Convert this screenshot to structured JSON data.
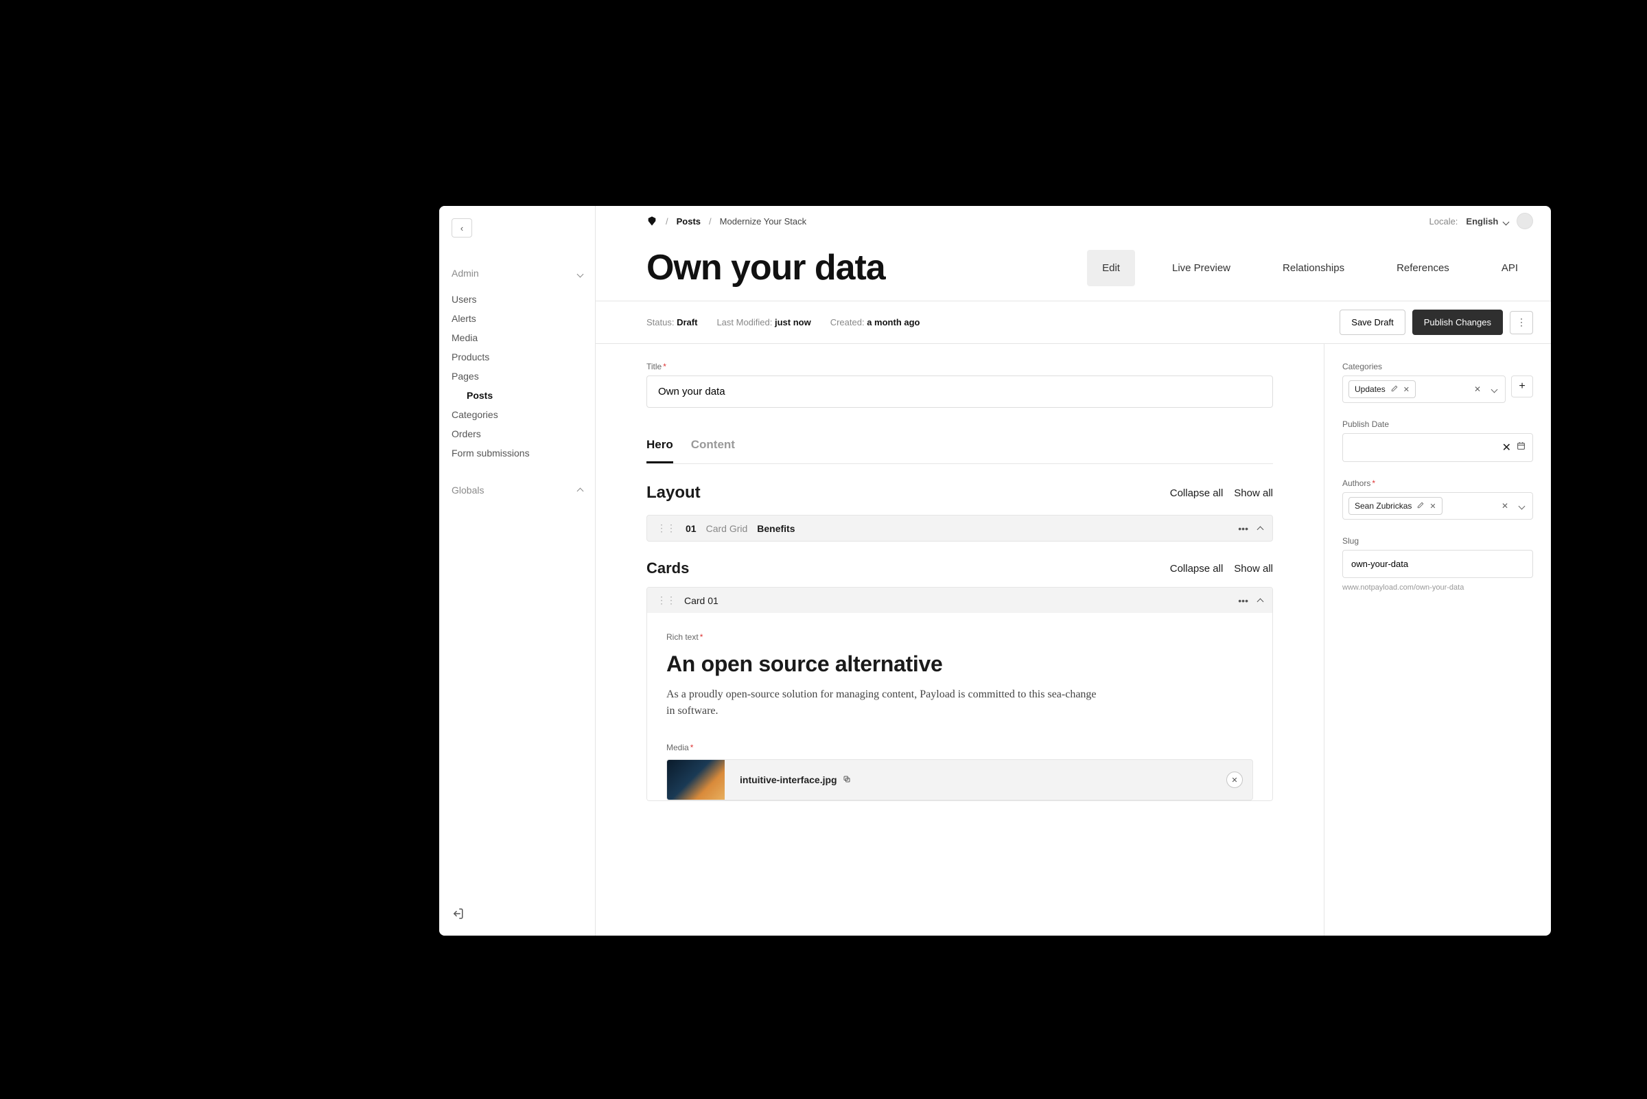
{
  "sidebar": {
    "groups": [
      {
        "label": "Admin",
        "items": [
          "Users",
          "Alerts",
          "Media",
          "Products",
          "Pages",
          "Posts",
          "Categories",
          "Orders",
          "Form submissions"
        ],
        "active": "Posts"
      },
      {
        "label": "Globals",
        "items": []
      }
    ]
  },
  "header": {
    "breadcrumb": {
      "collection": "Posts",
      "item": "Modernize Your Stack"
    },
    "locale_label": "Locale:",
    "locale_value": "English"
  },
  "page": {
    "title": "Own your data",
    "view_tabs": [
      "Edit",
      "Live Preview",
      "Relationships",
      "References",
      "API"
    ],
    "active_view": "Edit"
  },
  "status_bar": {
    "status_label": "Status:",
    "status_value": "Draft",
    "modified_label": "Last Modified:",
    "modified_value": "just now",
    "created_label": "Created:",
    "created_value": "a month ago",
    "save_draft": "Save Draft",
    "publish": "Publish Changes"
  },
  "form": {
    "title_label": "Title",
    "title_value": "Own your data",
    "tabs": [
      "Hero",
      "Content"
    ],
    "active_tab": "Hero",
    "layout": {
      "heading": "Layout",
      "collapse_all": "Collapse all",
      "show_all": "Show all",
      "block": {
        "index": "01",
        "type": "Card Grid",
        "name": "Benefits"
      }
    },
    "cards": {
      "heading": "Cards",
      "collapse_all": "Collapse all",
      "show_all": "Show all",
      "card": {
        "title": "Card 01",
        "rich_text_label": "Rich text",
        "rich_heading": "An open source alternative",
        "rich_body": "As a proudly open-source solution for managing content, Payload is committed to this sea-change in software.",
        "media_label": "Media",
        "media_filename": "intuitive-interface.jpg"
      }
    }
  },
  "side": {
    "categories_label": "Categories",
    "category_chip": "Updates",
    "publish_date_label": "Publish Date",
    "authors_label": "Authors",
    "author_chip": "Sean Zubrickas",
    "slug_label": "Slug",
    "slug_value": "own-your-data",
    "slug_preview": "www.notpayload.com/own-your-data"
  }
}
